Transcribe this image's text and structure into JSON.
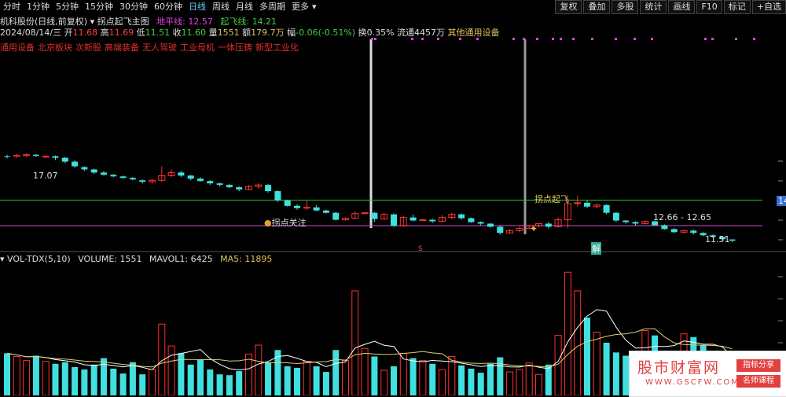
{
  "toolbar": {
    "periods": [
      "分时",
      "1分钟",
      "5分钟",
      "15分钟",
      "30分钟",
      "60分钟",
      "日线",
      "周线",
      "月线",
      "多周期",
      "更多"
    ],
    "active": "日线",
    "more_caret": "▾",
    "buttons": [
      "复权",
      "叠加",
      "多股",
      "统计",
      "画线",
      "F10",
      "标记",
      "+自选"
    ]
  },
  "header": {
    "stock": "机科股份(日线,前复权)",
    "arrow": "▾",
    "indicator": "拐点起飞主图",
    "ground_label": "地平线:",
    "ground_value": "12.57",
    "takeoff_label": "起飞线:",
    "takeoff_value": "14.21"
  },
  "quote": {
    "date": "2024/08/14/三",
    "open_label": "开",
    "open": "11.68",
    "high_label": "高",
    "high": "11.69",
    "low_label": "低",
    "low": "11.51",
    "close_label": "收",
    "close": "11.60",
    "vol_label": "量",
    "vol": "1551",
    "amt_label": "额",
    "amt": "179.7万",
    "chg_label": "幅",
    "chg": "-0.06(-0.51%)",
    "turn_label": "换",
    "turn": "0.35%",
    "float_label": "流通",
    "float": "4457万",
    "sector": "其他通用设备"
  },
  "tags": [
    "通用设备",
    "北京板块",
    "次新股",
    "高端装备",
    "无人驾驶",
    "工业母机",
    "一体压铸",
    "新型工业化"
  ],
  "annotations": {
    "high_mark": "17.07",
    "focus": "拐点关注",
    "takeoff": "拐点起飞",
    "range": "12.66 - 12.65",
    "low_mark": "11.51",
    "right_price": "14",
    "sell_marker": "S",
    "unlock": "解"
  },
  "volume": {
    "title": "VOL-TDX(5,10)",
    "vol_label": "VOLUME:",
    "vol": "1551",
    "mavol_label": "MAVOL1:",
    "mavol": "6425",
    "ma5_label": "MA5:",
    "ma5": "11895"
  },
  "watermark": {
    "title": "股市财富网",
    "url": "WWW.GSCFW.COM",
    "tag1": "指标分享",
    "tag2": "名师课程"
  },
  "chart_data": {
    "type": "candlestick",
    "ground_line": 12.57,
    "takeoff_line": 14.21,
    "candles": [
      [
        17.05,
        17.0,
        17.15,
        16.9
      ],
      [
        17.05,
        17.1,
        17.2,
        16.95
      ],
      [
        17.1,
        17.15,
        17.25,
        17.0
      ],
      [
        17.15,
        17.07,
        17.2,
        17.0
      ],
      [
        17.0,
        17.05,
        17.1,
        16.9
      ],
      [
        17.05,
        16.95,
        17.1,
        16.8
      ],
      [
        16.95,
        16.7,
        17.0,
        16.6
      ],
      [
        16.7,
        16.4,
        16.8,
        16.3
      ],
      [
        16.35,
        16.2,
        16.4,
        16.1
      ],
      [
        16.2,
        16.0,
        16.25,
        15.9
      ],
      [
        16.0,
        15.85,
        16.1,
        15.8
      ],
      [
        15.85,
        15.75,
        15.9,
        15.7
      ],
      [
        15.75,
        15.65,
        15.8,
        15.6
      ],
      [
        15.65,
        15.55,
        15.7,
        15.5
      ],
      [
        15.5,
        15.4,
        15.55,
        15.3
      ],
      [
        15.4,
        15.5,
        15.6,
        15.3
      ],
      [
        15.5,
        15.8,
        16.4,
        15.4
      ],
      [
        15.8,
        16.0,
        16.2,
        15.7
      ],
      [
        16.0,
        15.8,
        16.1,
        15.7
      ],
      [
        15.8,
        15.6,
        15.85,
        15.5
      ],
      [
        15.6,
        15.45,
        15.7,
        15.4
      ],
      [
        15.45,
        15.3,
        15.5,
        15.2
      ],
      [
        15.3,
        15.2,
        15.35,
        15.1
      ],
      [
        15.2,
        15.05,
        15.25,
        15.0
      ],
      [
        15.05,
        14.9,
        15.1,
        14.8
      ],
      [
        14.9,
        15.1,
        15.2,
        14.85
      ],
      [
        15.1,
        15.2,
        15.3,
        14.95
      ],
      [
        15.2,
        14.8,
        15.25,
        14.7
      ],
      [
        14.8,
        14.2,
        14.85,
        14.1
      ],
      [
        14.2,
        13.85,
        14.25,
        13.8
      ],
      [
        13.85,
        13.7,
        13.95,
        13.6
      ],
      [
        13.7,
        13.75,
        14.2,
        13.6
      ],
      [
        13.75,
        13.55,
        13.9,
        13.5
      ],
      [
        13.55,
        13.4,
        13.6,
        13.35
      ],
      [
        13.4,
        12.95,
        13.45,
        12.9
      ],
      [
        12.95,
        13.05,
        13.1,
        12.9
      ],
      [
        13.05,
        13.35,
        13.5,
        13.0
      ],
      [
        13.35,
        13.4,
        13.45,
        13.3
      ],
      [
        13.4,
        13.0,
        13.45,
        12.8
      ],
      [
        13.0,
        13.3,
        13.4,
        12.95
      ],
      [
        13.3,
        12.55,
        13.35,
        12.5
      ],
      [
        12.55,
        13.1,
        13.2,
        12.5
      ],
      [
        13.1,
        12.9,
        13.3,
        12.85
      ],
      [
        12.9,
        12.95,
        13.0,
        12.85
      ],
      [
        12.95,
        12.85,
        13.0,
        12.75
      ],
      [
        12.85,
        13.1,
        13.25,
        12.8
      ],
      [
        13.1,
        13.3,
        13.4,
        13.0
      ],
      [
        13.3,
        13.05,
        13.35,
        12.95
      ],
      [
        13.05,
        12.8,
        13.1,
        12.75
      ],
      [
        12.8,
        12.7,
        12.85,
        12.6
      ],
      [
        12.7,
        12.5,
        12.75,
        12.45
      ],
      [
        12.5,
        12.1,
        12.55,
        12.0
      ],
      [
        12.1,
        12.25,
        12.35,
        12.05
      ],
      [
        12.25,
        12.4,
        12.5,
        12.15
      ],
      [
        12.4,
        12.55,
        12.6,
        12.35
      ],
      [
        12.55,
        12.7,
        12.75,
        12.45
      ],
      [
        12.7,
        12.5,
        12.8,
        12.4
      ],
      [
        12.5,
        12.95,
        13.1,
        12.45
      ],
      [
        12.95,
        14.0,
        14.3,
        12.4
      ],
      [
        14.0,
        14.05,
        14.5,
        13.8
      ],
      [
        14.05,
        13.8,
        14.2,
        13.7
      ],
      [
        13.8,
        13.9,
        14.0,
        13.7
      ],
      [
        13.9,
        13.4,
        13.95,
        13.3
      ],
      [
        13.4,
        12.9,
        13.45,
        12.8
      ],
      [
        12.9,
        12.8,
        12.95,
        12.7
      ],
      [
        12.8,
        12.7,
        12.85,
        12.6
      ],
      [
        12.7,
        12.85,
        12.9,
        12.65
      ],
      [
        12.85,
        12.6,
        12.9,
        12.55
      ],
      [
        12.6,
        12.35,
        12.65,
        12.3
      ],
      [
        12.35,
        12.15,
        12.4,
        12.1
      ],
      [
        12.15,
        12.25,
        12.3,
        12.05
      ],
      [
        12.25,
        12.1,
        12.3,
        12.0
      ],
      [
        12.1,
        11.95,
        12.15,
        11.9
      ],
      [
        11.95,
        11.85,
        12.0,
        11.8
      ],
      [
        11.85,
        11.7,
        11.9,
        11.6
      ],
      [
        11.68,
        11.6,
        11.69,
        11.51
      ]
    ],
    "volumes": [
      5200,
      4800,
      4300,
      4900,
      4200,
      3900,
      4100,
      3500,
      3200,
      3800,
      4600,
      3300,
      2700,
      4100,
      2600,
      3200,
      8800,
      6100,
      5200,
      3800,
      4400,
      3200,
      2600,
      2500,
      3000,
      5100,
      6200,
      4100,
      5600,
      3600,
      3400,
      4200,
      3600,
      2900,
      5600,
      4300,
      12900,
      5800,
      4800,
      3100,
      3600,
      5200,
      4600,
      4300,
      3900,
      3200,
      4800,
      3700,
      3300,
      2800,
      3900,
      4700,
      2900,
      3200,
      4000,
      2600,
      3800,
      7400,
      15200,
      12900,
      9600,
      7800,
      6500,
      5300,
      4900,
      4700,
      8000,
      7400,
      5100,
      5500,
      7600,
      7200,
      6200,
      5100,
      3800,
      1551
    ]
  }
}
